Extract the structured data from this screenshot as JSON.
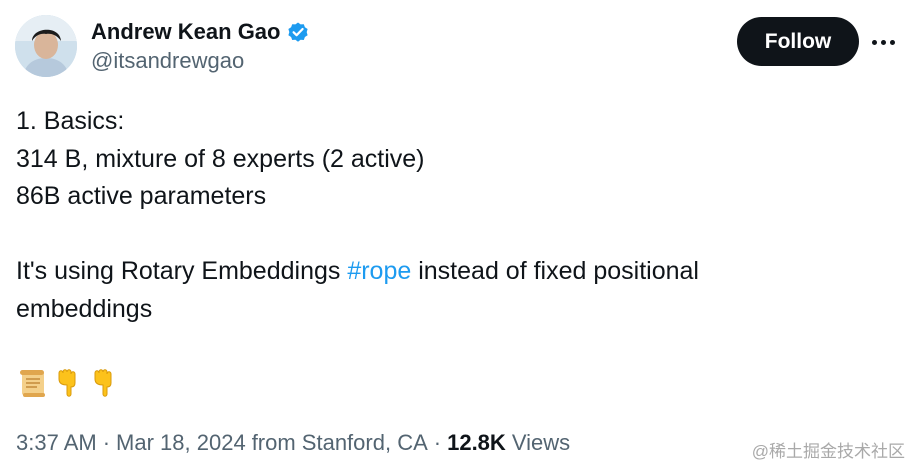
{
  "author": {
    "name": "Andrew Kean Gao",
    "handle": "@itsandrewgao",
    "verified_icon": "verified-badge-icon",
    "verified_color": "#1d9bf0"
  },
  "actions": {
    "follow_label": "Follow",
    "more_icon": "more-horizontal-icon"
  },
  "tweet": {
    "lines": [
      "1. Basics:",
      "314 B, mixture of 8 experts (2 active)",
      "86B active parameters"
    ],
    "rope_before": "It's using Rotary Embeddings ",
    "hashtag": "#rope",
    "rope_after": " instead of fixed positional",
    "rope_line2": "embeddings",
    "emojis": [
      "scroll-emoji",
      "backhand-index-pointing-down-emoji",
      "backhand-index-pointing-down-emoji"
    ]
  },
  "meta": {
    "time": "3:37 AM",
    "separator": "·",
    "date": "Mar 18, 2024",
    "location": "from Stanford, CA",
    "views_count": "12.8K",
    "views_label": "Views"
  },
  "watermark": "@稀土掘金技术社区",
  "colors": {
    "text": "#0f1419",
    "secondary": "#536471",
    "link": "#1d9bf0",
    "button_bg": "#0f1419"
  }
}
